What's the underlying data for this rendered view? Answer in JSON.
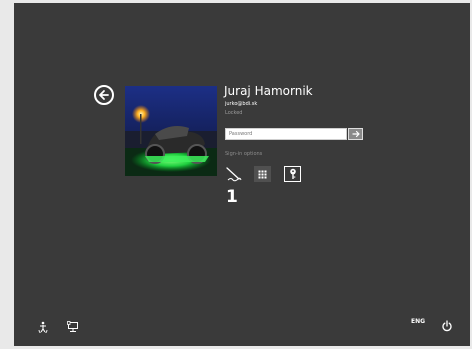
{
  "user": {
    "name": "Juraj Hamornik",
    "email": "jurko@bdi.sk",
    "status": "Locked"
  },
  "password": {
    "placeholder": "Password"
  },
  "sign_in_options": {
    "label": "Sign-in options",
    "options": [
      {
        "id": "picture-password",
        "icon": "picture-password-icon"
      },
      {
        "id": "pin",
        "icon": "pin-keypad-icon"
      },
      {
        "id": "password",
        "icon": "key-icon",
        "selected": true
      }
    ]
  },
  "callout_number": "1",
  "bottom_bar": {
    "left_icons": [
      "ease-of-access-icon",
      "network-icon"
    ],
    "language": "ENG",
    "right_icons": [
      "power-icon"
    ]
  },
  "colors": {
    "background": "#3a3a3a",
    "frame": "#e9e9e9",
    "text": "#ffffff",
    "muted_text": "#9a9a9a"
  }
}
